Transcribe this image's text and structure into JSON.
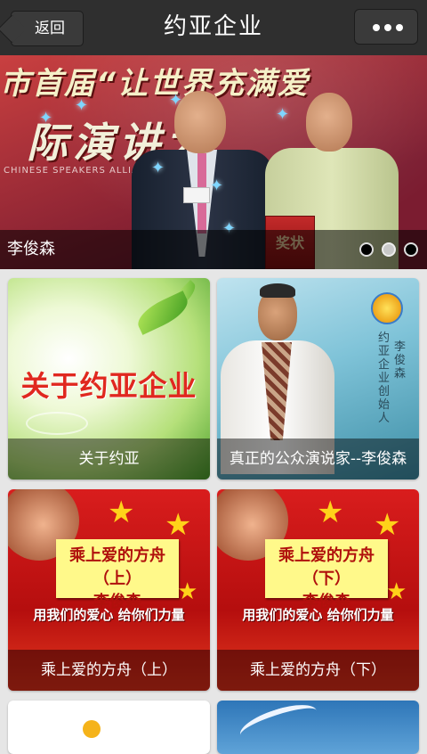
{
  "navbar": {
    "back_label": "返回",
    "title": "约亚企业",
    "more_icon": "more-dots-icon"
  },
  "banner": {
    "caption": "李俊森",
    "headline_line1": "市首届“让世界充满爱",
    "headline_line2": "际演讲大",
    "subtext": "CHINESE SPEAKERS ALLIANCE",
    "award_text": "奖状",
    "page_count": 3,
    "active_index": 1
  },
  "tiles": [
    {
      "caption": "关于约亚",
      "big_text": "关于约亚企业"
    },
    {
      "caption": "真正的公众演说家--李俊森",
      "calligraphy_a": "约亚企业创始人",
      "calligraphy_b": "李俊森"
    },
    {
      "caption": "乘上爱的方舟（上）",
      "note_line1": "乘上爱的方舟（上）",
      "note_line2": "李俊森",
      "slogan": "用我们的爱心 给你们力量"
    },
    {
      "caption": "乘上爱的方舟（下）",
      "note_line1": "乘上爱的方舟（下）",
      "note_line2": "李俊森",
      "slogan": "用我们的爱心 给你们力量"
    }
  ]
}
